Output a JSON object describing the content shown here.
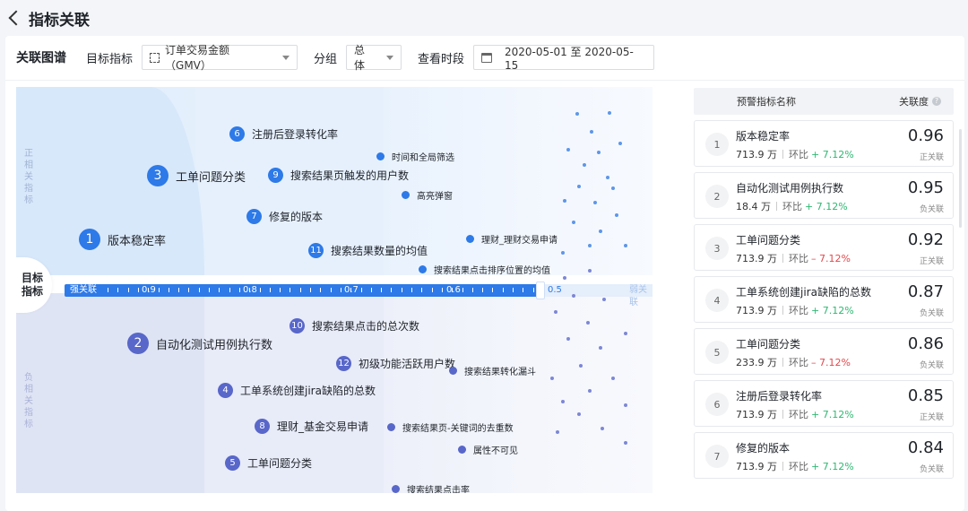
{
  "header": {
    "title": "指标关联"
  },
  "filters": {
    "title": "关联图谱",
    "metric_label": "目标指标",
    "metric_value": "订单交易金额（GMV）",
    "group_label": "分组",
    "group_value": "总体",
    "period_label": "查看时段",
    "period_value": "2020-05-01 至 2020-05-15"
  },
  "viz": {
    "pos_label": "正\n相\n关\n指\n标",
    "neg_label": "负\n相\n关\n指\n标",
    "target_label": "目标\n指标",
    "axis": {
      "strong": "强关联",
      "weak": "弱关联",
      "ticks": [
        "0.9",
        "0.8",
        "0.7",
        "0.6"
      ],
      "end": "0.5"
    },
    "pos_nodes": [
      {
        "num": "1",
        "label": "版本稳定率"
      },
      {
        "num": "3",
        "label": "工单问题分类"
      },
      {
        "num": "6",
        "label": "注册后登录转化率"
      },
      {
        "num": "7",
        "label": "修复的版本"
      },
      {
        "num": "9",
        "label": "搜索结果页触发的用户数"
      },
      {
        "num": "11",
        "label": "搜索结果数量的均值"
      }
    ],
    "pos_dots": [
      {
        "label": "时间和全局筛选"
      },
      {
        "label": "高亮弹窗"
      },
      {
        "label": "理财_理财交易申请"
      },
      {
        "label": "搜索结果点击排序位置的均值"
      }
    ],
    "neg_nodes": [
      {
        "num": "2",
        "label": "自动化测试用例执行数"
      },
      {
        "num": "4",
        "label": "工单系统创建jira缺陷的总数"
      },
      {
        "num": "5",
        "label": "工单问题分类"
      },
      {
        "num": "8",
        "label": "理财_基金交易申请"
      },
      {
        "num": "10",
        "label": "搜索结果点击的总次数"
      },
      {
        "num": "12",
        "label": "初级功能活跃用户数"
      }
    ],
    "neg_dots": [
      {
        "label": "搜索结果转化漏斗"
      },
      {
        "label": "搜索结果页-关键词的去重数"
      },
      {
        "label": "属性不可见"
      },
      {
        "label": "搜索结果点击率"
      }
    ]
  },
  "panel": {
    "col_name": "预警指标名称",
    "col_score": "关联度",
    "compare_label": "环比",
    "items": [
      {
        "rank": "1",
        "name": "版本稳定率",
        "value": "713.9 万",
        "change": "+ 7.12%",
        "trend": "up",
        "score": "0.96",
        "tag": "正关联"
      },
      {
        "rank": "2",
        "name": "自动化测试用例执行数",
        "value": "18.4 万",
        "change": "+ 7.12%",
        "trend": "up",
        "score": "0.95",
        "tag": "负关联"
      },
      {
        "rank": "3",
        "name": "工单问题分类",
        "value": "713.9 万",
        "change": "– 7.12%",
        "trend": "down",
        "score": "0.92",
        "tag": "正关联"
      },
      {
        "rank": "4",
        "name": "工单系统创建jira缺陷的总数",
        "value": "713.9 万",
        "change": "+ 7.12%",
        "trend": "up",
        "score": "0.87",
        "tag": "负关联"
      },
      {
        "rank": "5",
        "name": "工单问题分类",
        "value": "233.9 万",
        "change": "– 7.12%",
        "trend": "down",
        "score": "0.86",
        "tag": "负关联"
      },
      {
        "rank": "6",
        "name": "注册后登录转化率",
        "value": "713.9 万",
        "change": "+ 7.12%",
        "trend": "up",
        "score": "0.85",
        "tag": "正关联"
      },
      {
        "rank": "7",
        "name": "修复的版本",
        "value": "713.9 万",
        "change": "+ 7.12%",
        "trend": "up",
        "score": "0.84",
        "tag": "负关联"
      }
    ]
  },
  "colors": {
    "primary": "#2d7ae8",
    "negative": "#5867c9",
    "up": "#2eb872",
    "down": "#e5484d"
  }
}
